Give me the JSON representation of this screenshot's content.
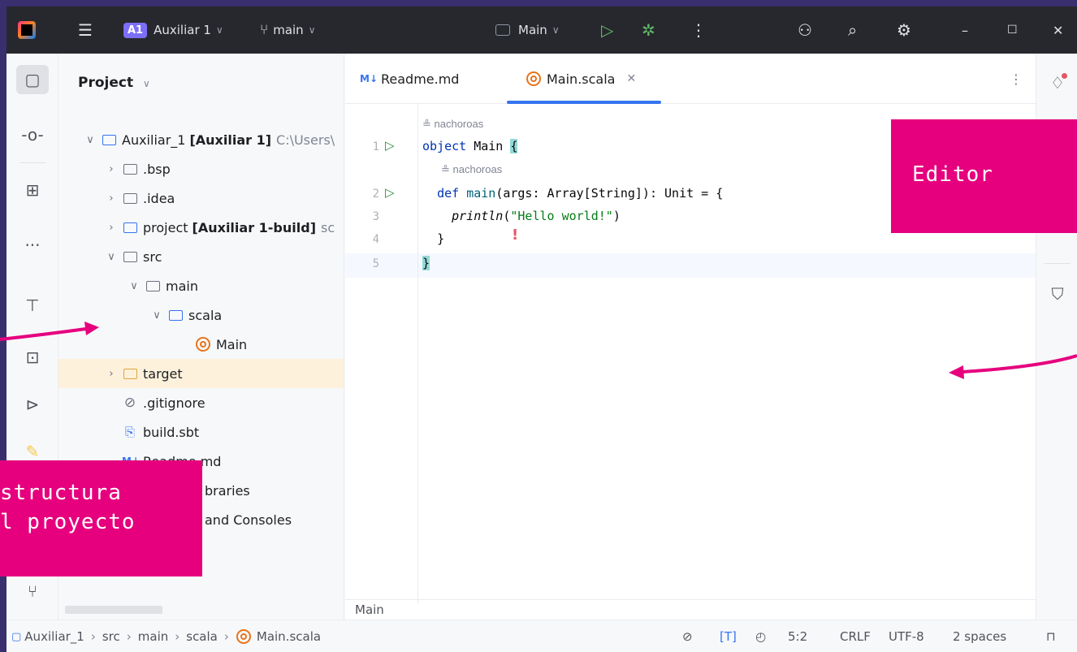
{
  "titlebar": {
    "project_badge": "A1",
    "project_name": "Auxiliar 1",
    "branch": "main",
    "run_config": "Main"
  },
  "project_panel": {
    "title": "Project",
    "tree": [
      {
        "label": "Auxiliar_1",
        "bold_suffix": "[Auxiliar 1]",
        "suffix": "C:\\Users\\"
      },
      {
        "label": ".bsp"
      },
      {
        "label": ".idea"
      },
      {
        "label": "project",
        "bold_suffix": "[Auxiliar 1-build]",
        "suffix": "sc"
      },
      {
        "label": "src"
      },
      {
        "label": "main"
      },
      {
        "label": "scala"
      },
      {
        "label": "Main"
      },
      {
        "label": "target"
      },
      {
        "label": ".gitignore"
      },
      {
        "label": "build.sbt"
      },
      {
        "label": "Readme.md"
      },
      {
        "label": "braries"
      },
      {
        "label": "and Consoles"
      }
    ]
  },
  "editor": {
    "tabs": [
      {
        "label": "Readme.md",
        "prefix": "M↓"
      },
      {
        "label": "Main.scala"
      }
    ],
    "author": "nachoroas",
    "lines": [
      {
        "num": "1",
        "kw": "object",
        "rest": " Main ",
        "brace": "{"
      },
      {
        "num": "2",
        "kw": "def",
        "fn": "main",
        "rest": "(args: Array[String]): Unit = {"
      },
      {
        "num": "3",
        "call": "println",
        "str": "\"Hello world!\"",
        "close": ")"
      },
      {
        "num": "4",
        "text": "}"
      },
      {
        "num": "5",
        "brace": "}"
      }
    ],
    "bottom_crumb": "Main"
  },
  "statusbar": {
    "crumbs": [
      "Auxiliar_1",
      "src",
      "main",
      "scala",
      "Main.scala"
    ],
    "tag": "[T]",
    "position": "5:2",
    "line_sep": "CRLF",
    "encoding": "UTF-8",
    "indent": "2 spaces"
  },
  "annotations": {
    "editor": "Editor",
    "structure_line1": "structura",
    "structure_line2": "l proyecto"
  },
  "colors": {
    "accent": "#3574f0",
    "callout": "#e6007e",
    "run_green": "#208a3c"
  }
}
